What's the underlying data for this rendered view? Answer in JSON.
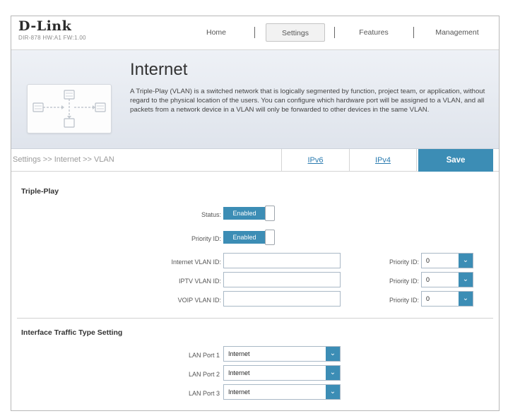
{
  "brand": {
    "logo": "D-Link",
    "model": "DIR-878 HW:A1 FW:1.00"
  },
  "nav": {
    "home": "Home",
    "settings": "Settings",
    "features": "Features",
    "management": "Management"
  },
  "banner": {
    "title": "Internet",
    "description": "A Triple-Play (VLAN) is a switched network that is logically segmented by function, project team, or application, without regard to the physical location of the users. You can configure which hardware port will be assigned to a VLAN, and all packets from a network device in a VLAN will only be forwarded to other devices in the same VLAN."
  },
  "breadcrumb": "Settings >> Internet >> VLAN",
  "tabs": {
    "ipv6": "IPv6",
    "ipv4": "IPv4",
    "save": "Save"
  },
  "triple_play": {
    "title": "Triple-Play",
    "status_label": "Status:",
    "status_value": "Enabled",
    "priority_id_label": "Priority ID:",
    "priority_id_value": "Enabled",
    "internet_vlan_label": "Internet VLAN ID:",
    "internet_vlan_value": "",
    "iptv_vlan_label": "IPTV VLAN ID:",
    "iptv_vlan_value": "",
    "voip_vlan_label": "VOIP VLAN ID:",
    "voip_vlan_value": "",
    "priority_label": "Priority ID:",
    "internet_priority": "0",
    "iptv_priority": "0",
    "voip_priority": "0"
  },
  "interface_traffic": {
    "title": "Interface Traffic Type Setting",
    "lan1_label": "LAN Port 1",
    "lan1_value": "Internet",
    "lan2_label": "LAN Port 2",
    "lan2_value": "Internet",
    "lan3_label": "LAN Port 3",
    "lan3_value": "Internet"
  },
  "colors": {
    "accent": "#3c8db5",
    "link": "#2a7bb0",
    "banner": "#e4e8ef"
  },
  "icons": {
    "dropdown": "chevron-down-icon",
    "diagram": "network-diagram-icon"
  }
}
